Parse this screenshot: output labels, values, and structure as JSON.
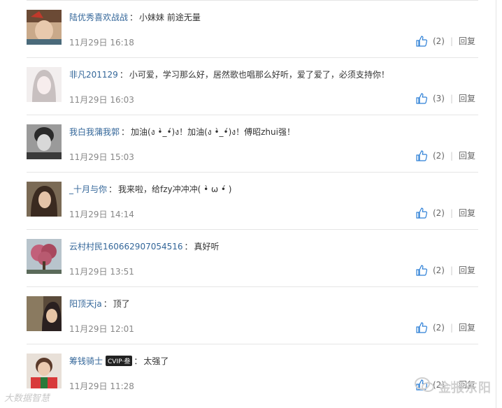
{
  "comments": [
    {
      "user": "陆优秀喜欢战战",
      "text": "小妹妹 前途无量",
      "time": "11月29日 16:18",
      "likes": "(2)",
      "reply": "回复"
    },
    {
      "user": "非凡201129",
      "text": "小可爱，学习那么好，居然歌也唱那么好听，爱了爱了，必须支持你！",
      "time": "11月29日 16:03",
      "likes": "(3)",
      "reply": "回复"
    },
    {
      "user": "我白我蒲我郭",
      "text": "加油(ง •̀_•́)ง！加油(ง •̀_•́)ง！傅昭zhui强！",
      "time": "11月29日 15:03",
      "likes": "(2)",
      "reply": "回复"
    },
    {
      "user": "_十月与你",
      "text": "我来啦，给fzy冲冲冲( •̀ ω •́ )",
      "time": "11月29日 14:14",
      "likes": "(2)",
      "reply": "回复"
    },
    {
      "user": "云村村民1606629070545​16",
      "text": "真好听",
      "time": "11月29日 13:51",
      "likes": "(2)",
      "reply": "回复"
    },
    {
      "user": "阳顶天ja",
      "text": "顶了",
      "time": "11月29日 12:01",
      "likes": "(2)",
      "reply": "回复"
    },
    {
      "user": "筹钱骑士",
      "badge": "CVIP·叁",
      "text": "太强了",
      "time": "11月29日 11:28",
      "likes": "(2)",
      "reply": "回复"
    }
  ],
  "watermark_left": "大数据智慧",
  "watermark_right": "金报东阳",
  "colors": {
    "link": "#336699",
    "accent": "#2c7fd6"
  }
}
